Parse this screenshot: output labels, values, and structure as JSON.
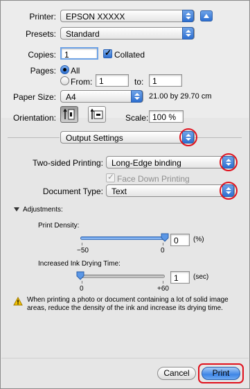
{
  "printer": {
    "label": "Printer:",
    "value": "EPSON XXXXX"
  },
  "presets": {
    "label": "Presets:",
    "value": "Standard"
  },
  "copies": {
    "label": "Copies:",
    "value": "1",
    "collated_label": "Collated",
    "collated_checked": true
  },
  "pages": {
    "label": "Pages:",
    "all_label": "All",
    "from_label": "From:",
    "from_value": "1",
    "to_label": "to:",
    "to_value": "1",
    "selected": "All"
  },
  "paper_size": {
    "label": "Paper Size:",
    "value": "A4",
    "dimensions": "21.00 by 29.70 cm"
  },
  "orientation": {
    "label": "Orientation:",
    "selected": "portrait",
    "scale_label": "Scale:",
    "scale_value": "100 %"
  },
  "section": {
    "value": "Output Settings"
  },
  "two_sided": {
    "label": "Two-sided Printing:",
    "value": "Long-Edge binding"
  },
  "face_down": {
    "label": "Face Down Printing",
    "checked": true,
    "disabled": true
  },
  "document_type": {
    "label": "Document Type:",
    "value": "Text"
  },
  "adjustments": {
    "label": "Adjustments:",
    "print_density": {
      "label": "Print Density:",
      "min_label": "−50",
      "max_label": "0",
      "value": "0",
      "unit": "(%)",
      "fraction": 1.0
    },
    "drying_time": {
      "label": "Increased Ink Drying Time:",
      "min_label": "0",
      "max_label": "+60",
      "value": "1",
      "unit": "(sec)",
      "fraction": 0.0
    }
  },
  "warning": {
    "icon": "warning-icon",
    "text": "When printing a photo or document containing a lot of solid image areas, reduce the density of the ink and increase its drying time."
  },
  "buttons": {
    "cancel": "Cancel",
    "print": "Print"
  },
  "colors": {
    "accent": "#3f86e6",
    "highlight": "#e0101c"
  }
}
